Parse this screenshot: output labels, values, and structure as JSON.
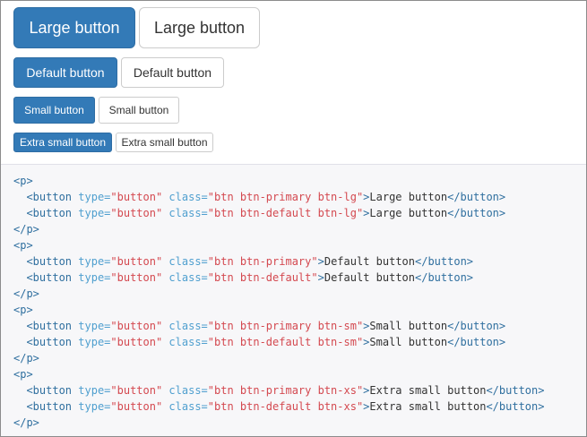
{
  "buttons": {
    "large_primary": "Large button",
    "large_default": "Large button",
    "default_primary": "Default button",
    "default_default": "Default button",
    "small_primary": "Small button",
    "small_default": "Small button",
    "xsmall_primary": "Extra small button",
    "xsmall_default": "Extra small button"
  },
  "code": {
    "p_open": "<p>",
    "p_close": "</p>",
    "indent": "  ",
    "btn_open": "<button",
    "btn_close": "</button>",
    "type_attr": "type=",
    "type_val": "\"button\"",
    "class_attr": "class=",
    "gt": ">",
    "class_lg_primary": "\"btn btn-primary btn-lg\"",
    "class_lg_default": "\"btn btn-default btn-lg\"",
    "class_primary": "\"btn btn-primary\"",
    "class_default": "\"btn btn-default\"",
    "class_sm_primary": "\"btn btn-primary btn-sm\"",
    "class_sm_default": "\"btn btn-default btn-sm\"",
    "class_xs_primary": "\"btn btn-primary btn-xs\"",
    "class_xs_default": "\"btn btn-default btn-xs\"",
    "text_large": "Large button",
    "text_default": "Default button",
    "text_small": "Small button",
    "text_xsmall": "Extra small button"
  },
  "colors": {
    "primary": "#337ab7",
    "code_bg": "#f7f7f9",
    "code_tag": "#2f6f9f",
    "code_string": "#d44950"
  }
}
